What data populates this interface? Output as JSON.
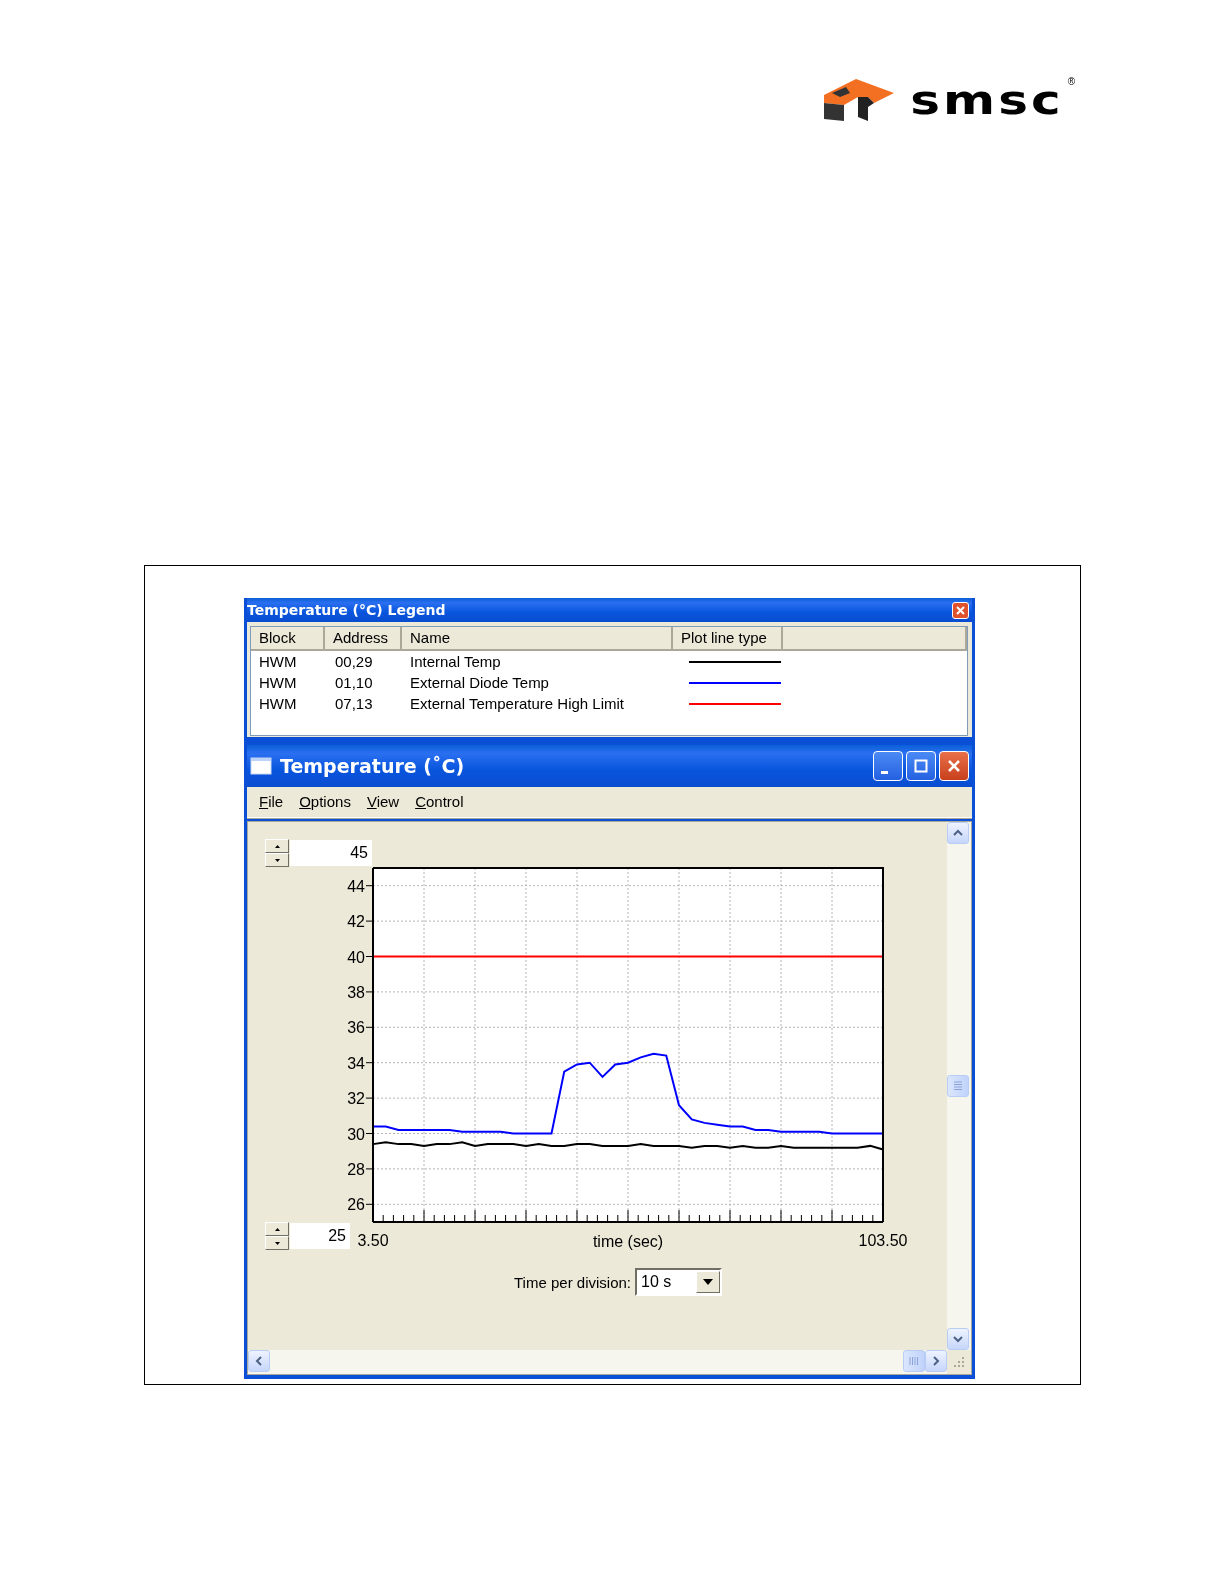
{
  "logo": {
    "text": "smsc",
    "mark": "®"
  },
  "legend_window": {
    "title": "Temperature (°C) Legend",
    "columns": [
      "Block",
      "Address",
      "Name",
      "Plot line type"
    ],
    "rows": [
      {
        "block": "HWM",
        "address": "00,29"
      },
      {
        "block": "HWM",
        "address": "01,10"
      },
      {
        "block": "HWM",
        "address": "07,13"
      }
    ]
  },
  "plot_window": {
    "title": "Temperature (˚C)",
    "menu": [
      "File",
      "Options",
      "View",
      "Control"
    ],
    "y_max": "45",
    "y_min": "25",
    "chart_data": {
      "type": "line",
      "grid": true,
      "xlabel": "time (sec)",
      "xlim": [
        3.5,
        103.5
      ],
      "ylim": [
        25,
        45
      ],
      "xticks": [
        {
          "value": 3.5,
          "label": "3.50"
        },
        {
          "value": 103.5,
          "label": "103.50"
        }
      ],
      "yticks": [
        26,
        28,
        30,
        32,
        34,
        36,
        38,
        40,
        42,
        44
      ],
      "x": [
        3.5,
        6,
        8.5,
        11,
        13.5,
        16,
        18.5,
        21,
        23.5,
        26,
        28.5,
        31,
        33.5,
        36,
        38.5,
        41,
        43.5,
        46,
        48.5,
        51,
        53.5,
        56,
        58.5,
        61,
        63.5,
        66,
        68.5,
        71,
        73.5,
        76,
        78.5,
        81,
        83.5,
        86,
        88.5,
        91,
        93.5,
        96,
        98.5,
        101,
        103.5
      ],
      "series": [
        {
          "name": "Internal Temp",
          "color": "#000000",
          "values": [
            29.4,
            29.5,
            29.4,
            29.4,
            29.3,
            29.4,
            29.4,
            29.5,
            29.3,
            29.4,
            29.4,
            29.4,
            29.3,
            29.4,
            29.3,
            29.3,
            29.4,
            29.4,
            29.3,
            29.3,
            29.3,
            29.4,
            29.3,
            29.3,
            29.3,
            29.2,
            29.3,
            29.3,
            29.2,
            29.3,
            29.2,
            29.2,
            29.3,
            29.2,
            29.2,
            29.2,
            29.2,
            29.2,
            29.2,
            29.3,
            29.1
          ]
        },
        {
          "name": "External Diode Temp",
          "color": "#0000ff",
          "values": [
            30.4,
            30.4,
            30.2,
            30.2,
            30.2,
            30.2,
            30.2,
            30.1,
            30.1,
            30.1,
            30.1,
            30.0,
            30.0,
            30.0,
            30.0,
            33.5,
            33.9,
            34.0,
            33.2,
            33.9,
            34.0,
            34.3,
            34.5,
            34.4,
            31.6,
            30.8,
            30.6,
            30.5,
            30.4,
            30.4,
            30.2,
            30.2,
            30.1,
            30.1,
            30.1,
            30.1,
            30.0,
            30.0,
            30.0,
            30.0,
            30.0
          ]
        },
        {
          "name": "External Temperature High Limit",
          "color": "#ff0000",
          "values": [
            40,
            40,
            40,
            40,
            40,
            40,
            40,
            40,
            40,
            40,
            40,
            40,
            40,
            40,
            40,
            40,
            40,
            40,
            40,
            40,
            40,
            40,
            40,
            40,
            40,
            40,
            40,
            40,
            40,
            40,
            40,
            40,
            40,
            40,
            40,
            40,
            40,
            40,
            40,
            40,
            40
          ]
        }
      ]
    },
    "time_per_division": {
      "label": "Time per division:",
      "value": "10 s"
    }
  }
}
